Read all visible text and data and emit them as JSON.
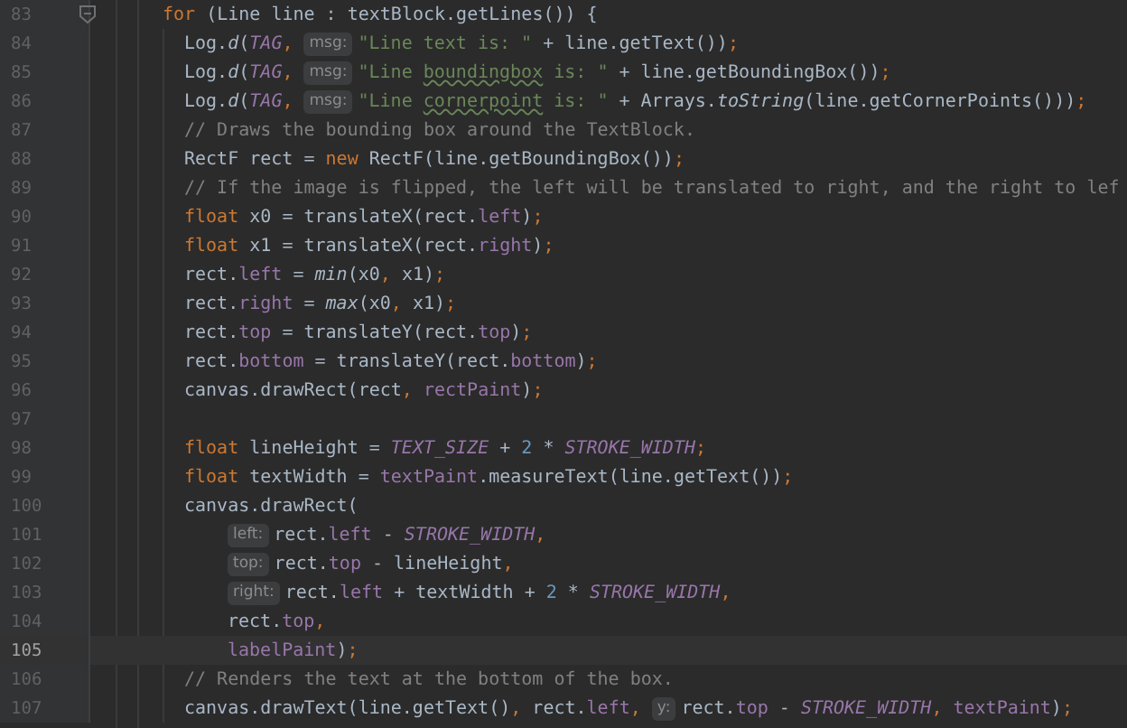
{
  "editor": {
    "lines": [
      {
        "number": "83",
        "current": false,
        "folded_marker": true,
        "kind": "block",
        "tokens": [
          {
            "kind": "kw",
            "text": "for"
          },
          {
            "kind": "plain",
            "text": " (Line line : textBlock.getLines()) {"
          }
        ]
      },
      {
        "number": "84",
        "current": false,
        "kind": "statement",
        "tokens": [
          {
            "kind": "plain",
            "text": "Log."
          },
          {
            "kind": "static",
            "text": "d"
          },
          {
            "kind": "plain",
            "text": "("
          },
          {
            "kind": "const",
            "text": "TAG"
          },
          {
            "kind": "punct",
            "text": ", "
          },
          {
            "kind": "hint",
            "text": "msg:"
          },
          {
            "kind": "str",
            "text": "\"Line text is: \""
          },
          {
            "kind": "plain",
            "text": " + line.getText())"
          },
          {
            "kind": "punct",
            "text": ";"
          }
        ]
      },
      {
        "number": "85",
        "current": false,
        "kind": "statement",
        "tokens": [
          {
            "kind": "plain",
            "text": "Log."
          },
          {
            "kind": "static",
            "text": "d"
          },
          {
            "kind": "plain",
            "text": "("
          },
          {
            "kind": "const",
            "text": "TAG"
          },
          {
            "kind": "punct",
            "text": ", "
          },
          {
            "kind": "hint",
            "text": "msg:"
          },
          {
            "kind": "str",
            "text": "\"Line "
          },
          {
            "kind": "typo",
            "text": "boundingbox"
          },
          {
            "kind": "str",
            "text": " is: \""
          },
          {
            "kind": "plain",
            "text": " + line.getBoundingBox())"
          },
          {
            "kind": "punct",
            "text": ";"
          }
        ]
      },
      {
        "number": "86",
        "current": false,
        "kind": "statement",
        "tokens": [
          {
            "kind": "plain",
            "text": "Log."
          },
          {
            "kind": "static",
            "text": "d"
          },
          {
            "kind": "plain",
            "text": "("
          },
          {
            "kind": "const",
            "text": "TAG"
          },
          {
            "kind": "punct",
            "text": ", "
          },
          {
            "kind": "hint",
            "text": "msg:"
          },
          {
            "kind": "str",
            "text": "\"Line "
          },
          {
            "kind": "typo",
            "text": "cornerpoint"
          },
          {
            "kind": "str",
            "text": " is: \""
          },
          {
            "kind": "plain",
            "text": " + Arrays."
          },
          {
            "kind": "static",
            "text": "toString"
          },
          {
            "kind": "plain",
            "text": "(line.getCornerPoints()))"
          },
          {
            "kind": "punct",
            "text": ";"
          }
        ]
      },
      {
        "number": "87",
        "current": false,
        "kind": "statement",
        "tokens": [
          {
            "kind": "comment",
            "text": "// Draws the bounding box around the TextBlock."
          }
        ]
      },
      {
        "number": "88",
        "current": false,
        "kind": "statement",
        "tokens": [
          {
            "kind": "plain",
            "text": "RectF rect = "
          },
          {
            "kind": "kw",
            "text": "new"
          },
          {
            "kind": "plain",
            "text": " RectF(line.getBoundingBox())"
          },
          {
            "kind": "punct",
            "text": ";"
          }
        ]
      },
      {
        "number": "89",
        "current": false,
        "kind": "statement",
        "tokens": [
          {
            "kind": "comment",
            "text": "// If the image is flipped, the left will be translated to right, and the right to lef"
          }
        ]
      },
      {
        "number": "90",
        "current": false,
        "kind": "statement",
        "tokens": [
          {
            "kind": "kw",
            "text": "float"
          },
          {
            "kind": "plain",
            "text": " x0 = translateX(rect."
          },
          {
            "kind": "field",
            "text": "left"
          },
          {
            "kind": "plain",
            "text": ")"
          },
          {
            "kind": "punct",
            "text": ";"
          }
        ]
      },
      {
        "number": "91",
        "current": false,
        "kind": "statement",
        "tokens": [
          {
            "kind": "kw",
            "text": "float"
          },
          {
            "kind": "plain",
            "text": " x1 = translateX(rect."
          },
          {
            "kind": "field",
            "text": "right"
          },
          {
            "kind": "plain",
            "text": ")"
          },
          {
            "kind": "punct",
            "text": ";"
          }
        ]
      },
      {
        "number": "92",
        "current": false,
        "kind": "statement",
        "tokens": [
          {
            "kind": "plain",
            "text": "rect."
          },
          {
            "kind": "field",
            "text": "left"
          },
          {
            "kind": "plain",
            "text": " = "
          },
          {
            "kind": "static",
            "text": "min"
          },
          {
            "kind": "plain",
            "text": "(x0"
          },
          {
            "kind": "punct",
            "text": ","
          },
          {
            "kind": "plain",
            "text": " x1)"
          },
          {
            "kind": "punct",
            "text": ";"
          }
        ]
      },
      {
        "number": "93",
        "current": false,
        "kind": "statement",
        "tokens": [
          {
            "kind": "plain",
            "text": "rect."
          },
          {
            "kind": "field",
            "text": "right"
          },
          {
            "kind": "plain",
            "text": " = "
          },
          {
            "kind": "static",
            "text": "max"
          },
          {
            "kind": "plain",
            "text": "(x0"
          },
          {
            "kind": "punct",
            "text": ","
          },
          {
            "kind": "plain",
            "text": " x1)"
          },
          {
            "kind": "punct",
            "text": ";"
          }
        ]
      },
      {
        "number": "94",
        "current": false,
        "kind": "statement",
        "tokens": [
          {
            "kind": "plain",
            "text": "rect."
          },
          {
            "kind": "field",
            "text": "top"
          },
          {
            "kind": "plain",
            "text": " = translateY(rect."
          },
          {
            "kind": "field",
            "text": "top"
          },
          {
            "kind": "plain",
            "text": ")"
          },
          {
            "kind": "punct",
            "text": ";"
          }
        ]
      },
      {
        "number": "95",
        "current": false,
        "kind": "statement",
        "tokens": [
          {
            "kind": "plain",
            "text": "rect."
          },
          {
            "kind": "field",
            "text": "bottom"
          },
          {
            "kind": "plain",
            "text": " = translateY(rect."
          },
          {
            "kind": "field",
            "text": "bottom"
          },
          {
            "kind": "plain",
            "text": ")"
          },
          {
            "kind": "punct",
            "text": ";"
          }
        ]
      },
      {
        "number": "96",
        "current": false,
        "kind": "statement",
        "tokens": [
          {
            "kind": "plain",
            "text": "canvas.drawRect(rect"
          },
          {
            "kind": "punct",
            "text": ", "
          },
          {
            "kind": "field",
            "text": "rectPaint"
          },
          {
            "kind": "plain",
            "text": ")"
          },
          {
            "kind": "punct",
            "text": ";"
          }
        ]
      },
      {
        "number": "97",
        "current": false,
        "kind": "statement"
      },
      {
        "number": "98",
        "current": false,
        "kind": "statement",
        "tokens": [
          {
            "kind": "kw",
            "text": "float"
          },
          {
            "kind": "plain",
            "text": " lineHeight = "
          },
          {
            "kind": "const",
            "text": "TEXT_SIZE"
          },
          {
            "kind": "plain",
            "text": " + "
          },
          {
            "kind": "num",
            "text": "2"
          },
          {
            "kind": "plain",
            "text": " * "
          },
          {
            "kind": "const",
            "text": "STROKE_WIDTH"
          },
          {
            "kind": "punct",
            "text": ";"
          }
        ]
      },
      {
        "number": "99",
        "current": false,
        "kind": "statement",
        "tokens": [
          {
            "kind": "kw",
            "text": "float"
          },
          {
            "kind": "plain",
            "text": " textWidth = "
          },
          {
            "kind": "field",
            "text": "textPaint"
          },
          {
            "kind": "plain",
            "text": ".measureText(line.getText())"
          },
          {
            "kind": "punct",
            "text": ";"
          }
        ]
      },
      {
        "number": "100",
        "current": false,
        "kind": "statement",
        "tokens": [
          {
            "kind": "plain",
            "text": "canvas.drawRect("
          }
        ]
      },
      {
        "number": "101",
        "current": false,
        "kind": "argument",
        "tokens": [
          {
            "kind": "hint",
            "text": "left:"
          },
          {
            "kind": "plain",
            "text": "rect."
          },
          {
            "kind": "field",
            "text": "left"
          },
          {
            "kind": "plain",
            "text": " - "
          },
          {
            "kind": "const",
            "text": "STROKE_WIDTH"
          },
          {
            "kind": "punct",
            "text": ","
          }
        ]
      },
      {
        "number": "102",
        "current": false,
        "kind": "argument",
        "tokens": [
          {
            "kind": "hint",
            "text": "top:"
          },
          {
            "kind": "plain",
            "text": "rect."
          },
          {
            "kind": "field",
            "text": "top"
          },
          {
            "kind": "plain",
            "text": " - lineHeight"
          },
          {
            "kind": "punct",
            "text": ","
          }
        ]
      },
      {
        "number": "103",
        "current": false,
        "kind": "argument",
        "tokens": [
          {
            "kind": "hint",
            "text": "right:"
          },
          {
            "kind": "plain",
            "text": "rect."
          },
          {
            "kind": "field",
            "text": "left"
          },
          {
            "kind": "plain",
            "text": " + textWidth + "
          },
          {
            "kind": "num",
            "text": "2"
          },
          {
            "kind": "plain",
            "text": " * "
          },
          {
            "kind": "const",
            "text": "STROKE_WIDTH"
          },
          {
            "kind": "punct",
            "text": ","
          }
        ]
      },
      {
        "number": "104",
        "current": false,
        "kind": "argument",
        "tokens": [
          {
            "kind": "plain",
            "text": "rect."
          },
          {
            "kind": "field",
            "text": "top"
          },
          {
            "kind": "punct",
            "text": ","
          }
        ]
      },
      {
        "number": "105",
        "current": true,
        "kind": "argument",
        "tokens": [
          {
            "kind": "field",
            "text": "labelPaint"
          },
          {
            "kind": "plain",
            "text": ")"
          },
          {
            "kind": "punct",
            "text": ";"
          }
        ]
      },
      {
        "number": "106",
        "current": false,
        "kind": "statement",
        "tokens": [
          {
            "kind": "comment",
            "text": "// Renders the text at the bottom of the box."
          }
        ]
      },
      {
        "number": "107",
        "current": false,
        "kind": "statement",
        "tokens": [
          {
            "kind": "plain",
            "text": "canvas.drawText(line.getText()"
          },
          {
            "kind": "punct",
            "text": ","
          },
          {
            "kind": "plain",
            "text": " rect."
          },
          {
            "kind": "field",
            "text": "left"
          },
          {
            "kind": "punct",
            "text": ", "
          },
          {
            "kind": "hint",
            "text": "y:"
          },
          {
            "kind": "plain",
            "text": "rect."
          },
          {
            "kind": "field",
            "text": "top"
          },
          {
            "kind": "plain",
            "text": " - "
          },
          {
            "kind": "const",
            "text": "STROKE_WIDTH"
          },
          {
            "kind": "punct",
            "text": ", "
          },
          {
            "kind": "field",
            "text": "textPaint"
          },
          {
            "kind": "plain",
            "text": ")"
          },
          {
            "kind": "punct",
            "text": ";"
          }
        ]
      }
    ]
  }
}
